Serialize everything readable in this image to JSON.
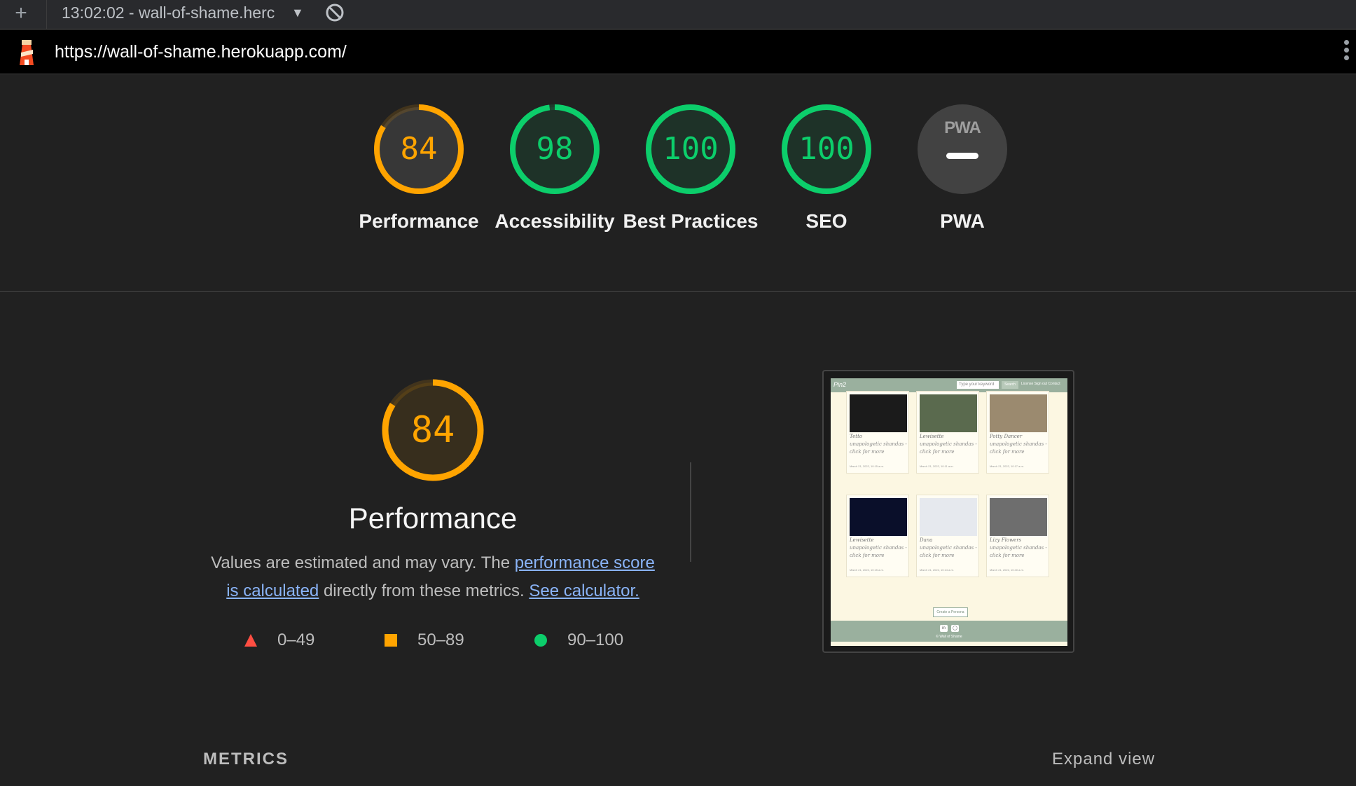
{
  "browser": {
    "new_tab_label": "+",
    "tab_title": "13:02:02 - wall-of-shame.herc",
    "caret": "▼",
    "url": "https://wall-of-shame.herokuapp.com/"
  },
  "colors": {
    "pass": "#0cce6b",
    "average": "#ffa400",
    "fail": "#ff4e42",
    "pwa_gray": "#424242"
  },
  "scores": [
    {
      "label": "Performance",
      "value": "84",
      "score": 84,
      "rating": "average"
    },
    {
      "label": "Accessibility",
      "value": "98",
      "score": 98,
      "rating": "pass"
    },
    {
      "label": "Best Practices",
      "value": "100",
      "score": 100,
      "rating": "pass"
    },
    {
      "label": "SEO",
      "value": "100",
      "score": 100,
      "rating": "pass"
    },
    {
      "label": "PWA",
      "value": "PWA",
      "rating": "na"
    }
  ],
  "performance": {
    "score": "84",
    "score_value": 84,
    "title": "Performance",
    "desc_before": "Values are estimated and may vary. The ",
    "desc_link1": "performance score is calculated",
    "desc_middle": " directly from these metrics. ",
    "desc_link2": "See calculator."
  },
  "legend": [
    {
      "range": "0–49",
      "shape": "triangle",
      "color": "#ff4e42"
    },
    {
      "range": "50–89",
      "shape": "square",
      "color": "#ffa400"
    },
    {
      "range": "90–100",
      "shape": "circle",
      "color": "#0cce6b"
    }
  ],
  "screenshot": {
    "brand": "Pin2",
    "search_placeholder": "Type your keyword",
    "search_button": "Search",
    "nav_links": "License  Sign out  Contact",
    "cards": [
      {
        "title": "Tetto",
        "text": "unapologetic shandas - click for more",
        "date": "March 21, 2022, 10:15 a.m.",
        "img": "#1b1b1b"
      },
      {
        "title": "Lewisette",
        "text": "unapologetic shandas - click for more",
        "date": "March 21, 2022, 10:11 a.m.",
        "img": "#5a6a4e"
      },
      {
        "title": "Potty Dancer",
        "text": "unapologetic shandas - click for more",
        "date": "March 21, 2022, 10:17 a.m.",
        "img": "#9b8a6f"
      },
      {
        "title": "Lewisette",
        "text": "unapologetic shandas - click for more",
        "date": "March 21, 2022, 10:15 a.m.",
        "img": "#0a0f2a"
      },
      {
        "title": "Dana",
        "text": "unapologetic shandas - click for more",
        "date": "March 21, 2022, 10:14 a.m.",
        "img": "#e6e9ee"
      },
      {
        "title": "Lizy Flowers",
        "text": "unapologetic shandas - click for more",
        "date": "March 21, 2022, 10:40 a.m.",
        "img": "#6e6e6e"
      }
    ],
    "create_button": "Create a Persona",
    "footer_text": "© Wall of Shame"
  },
  "metrics": {
    "title": "METRICS",
    "expand": "Expand view"
  }
}
